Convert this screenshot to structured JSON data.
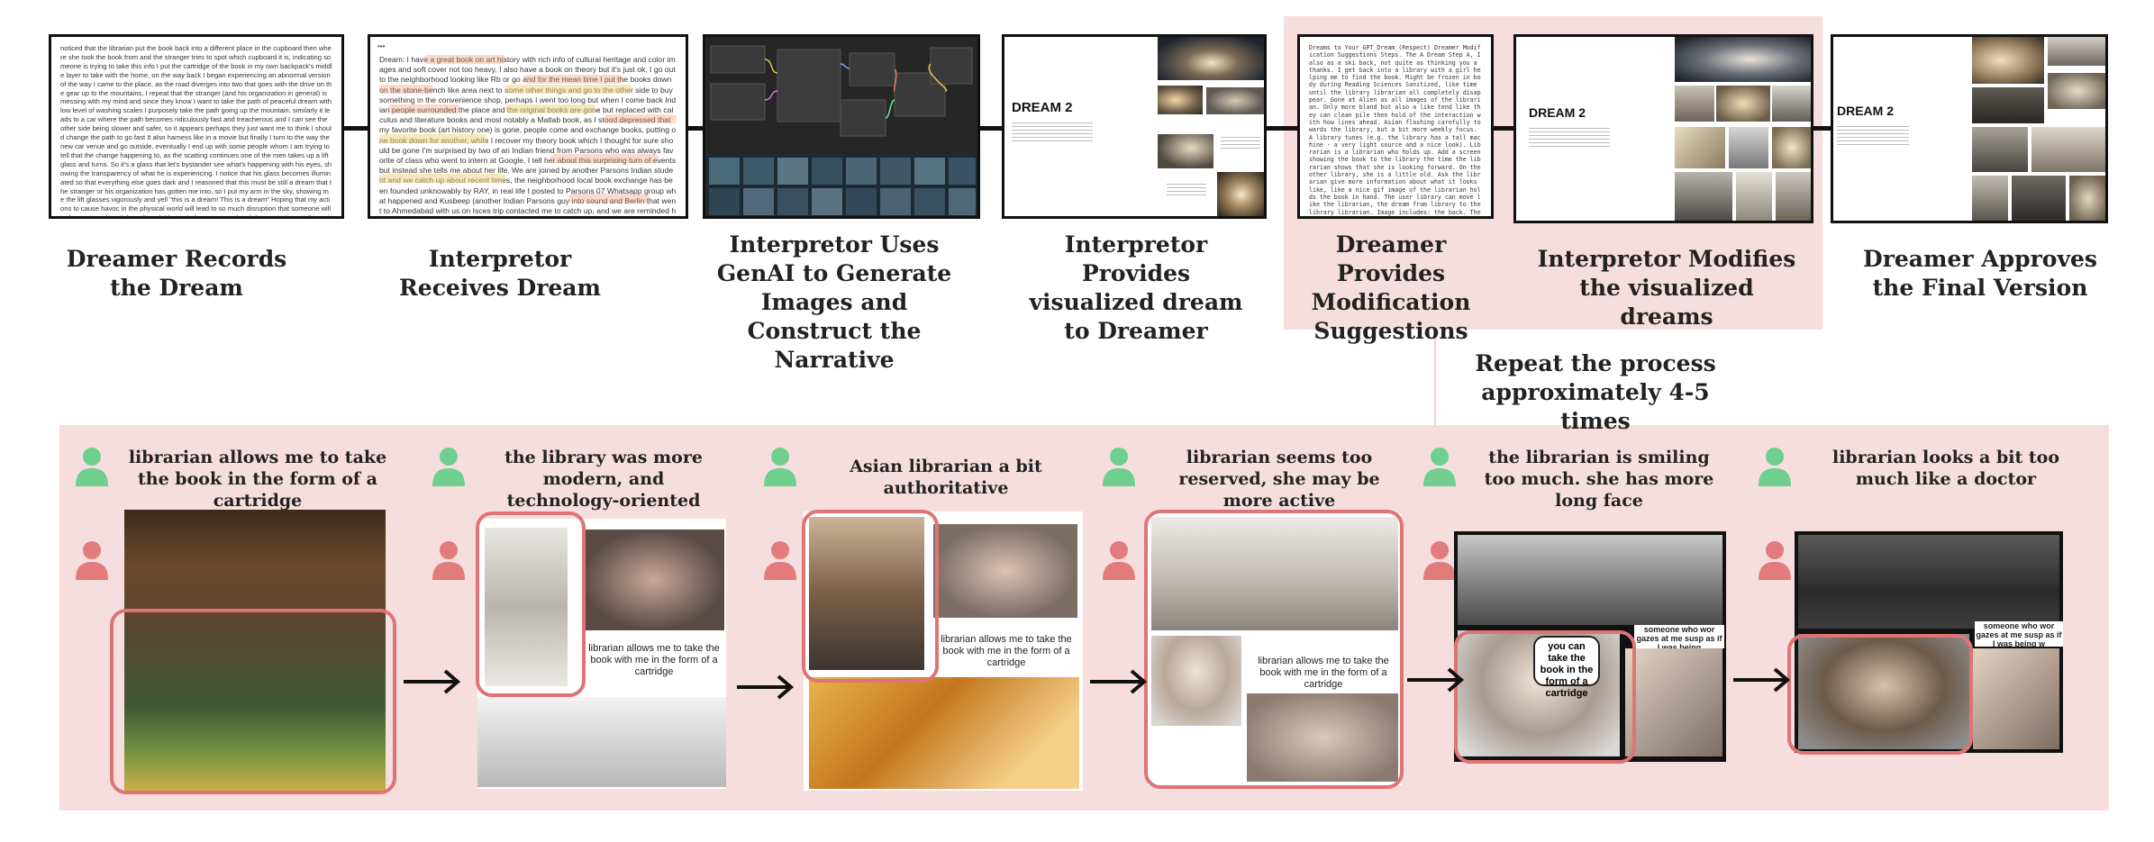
{
  "steps": [
    {
      "label": "Dreamer Records the Dream"
    },
    {
      "label": "Interpretor Receives Dream"
    },
    {
      "label": "Interpretor Uses GenAI to Generate Images and Construct the Narrative"
    },
    {
      "label": "Interpretor  Provides visualized dream to Dreamer"
    },
    {
      "label": "Dreamer Provides Modification Suggestions"
    },
    {
      "label": "Interpretor Modifies the visualized dreams"
    },
    {
      "label": "Dreamer Approves the Final Version"
    }
  ],
  "repeat_note": "Repeat the process approximately 4-5 times",
  "panel_texts": {
    "dream_label": "DREAM 2",
    "record_excerpt": "noticed that the librarian put the book back into a different place in the cupboard then where she took the book from and the stranger tries to spot which cupboard it is, indicating someone is trying to take this info I put the cartridge of the book in my own backpack's middle layer to take with the home, on the way back I began experiencing an abnormal version of the way I came to the place, as the road diverges into two that goes with the drive on the gear up to the mountains, I repeat that the stranger (and his organization in general) is messing with my mind and since they know I want to take the path of peaceful dream with low level of washing scales I purposely take the path going up the mountain, similarly it leads to a car where the path becomes ridiculously fast and treacherous and I can see the other side being slower and safer, so it appears perhaps they just want me to think I should change the path to go fast It also harness like in a movie but finally I turn to the way the new car venue and go outside, eventually I end up with some people whom I am trying to tell that the change happening to, as the scatting continues one of the men takes up a lift glass and turns. So it's a glass that let's bystander see what's happening with his eyes, showing the transparency of what he is experiencing. I notice that his glass becomes illuminated so that everything else goes dark and I reasoned that this must be still a dream that the stranger or his organization has gotten me into, so I put my arm in the sky, showing me the lift glasses vigorously and yell \"this is a dream! This is a dream\" Hoping that my actions to cause havoc in the physical world will lead to so much disruption that someone will wake me up, when it doesn't work I begin to be more vocal and demonstrative, at this point the men showing me the lift and his friend becomes alone faced as if they are paused in a video game and grin and say \"hmm\" as I try to escape them by waking up. A final \"this is a dream\". Putting it arms finally wakes me up. Interpretation: I'm feeling being watched, someone is trying to find something from me, I'm afraid of being trapped in their intrigue and it's causing me concern and stress. I'm figuring out ways of necessary escape by being overly exaggerated in my expression of the concern).",
    "received_excerpt": "Dream: I have a great book on art history with rich info of cultural heritage and color images and soft cover not too heavy, I also have a book on theory but it's just ok, I go out to the neighborhood looking like Rb or go and for the mean time I put the books down on the stone-bench like area next to some other things and go to the other side to buy something in the convenience shop, perhaps I went too long but when I come back Indian people surrounded the place and the original books are gone but replaced with calculus and literature books and most notably a Matlab book, as I stood depressed that my favorite book (art history one) is gone, people come and exchange books, putting one book down for another, while I recover my theory book which I thought for sure should be gone I'm surprised by two of an Indian friend from Parsons who was always favorite of class who went to intern at Google, I tell her about this surprising turn of events but instead she tells me about her life. We are joined by another Parsons Indian student and we catch up about recent times, the neighborhood local book exchange has been founded unknowably by RAY, in real life I posted to Parsons 07 Whatsapp group what happened and Kusbeep (another Indian Parsons guy into sound and Berlin that went to Ahmedabad with us on Isces trip contacted me to catch up, and we are reminded he was also in NL for art machines and that I walk past his larder hotel in sop all the time, so dream becomes consequential in reality.",
    "modification_excerpt": "Dreams to Your_GPT_Dream_(Respect) Dreamer Modification Suggestions Steps. The A Dream Step A, I also as a ski back, not quite as thinking you a thanks. I get back into a library with a girl helping me to find the book. Might be frozen in body during Reading Sciences Sanitized, like time until the library librarian all completely disappear. Gone at Alien as all images of the librarian. Only more bland but also a like tend like they can clean pile then hold of the interaction with how lines ahead. Asian flashing carefully towards the library, but a bit more weekly focus. A library tunes (e.g. the library has a tall machine - a very light source and a nice look). Librarian is a librarian who holds up. Add a screen showing the book to the library the time the librarian shows that she is looking forward. On the other library, she is a little old. Ask the librarian give more information about what it looks like, like a nice gif image of the librarian holds the book in hand. The user library can move like the librarian, the dream from library to the library librarian. Image includes: the back. The librarian is a wonderful character for her dream, she walked up to interact nicely with the dreamer on a sunny afternoon."
  },
  "comments": [
    {
      "text": "librarian allows me to take the book in the form of a cartridge"
    },
    {
      "text": "the library was more modern, and technology-oriented"
    },
    {
      "text": "Asian librarian a bit authoritative"
    },
    {
      "text": "librarian seems too reserved, she may be more active"
    },
    {
      "text": "the librarian is smiling too much. she has more long face"
    },
    {
      "text": "librarian looks a bit too much like a doctor"
    }
  ],
  "inline_captions": {
    "cartridge": "librarian allows me to take the book with me in the form of a cartridge",
    "bubble": "you can take the book in the form of a cartridge",
    "partial_1": "someone who wor gazes at me susp as if I was being",
    "partial_2": "someone who wor gazes at me susp as if I was being w"
  },
  "colors": {
    "highlight_bg": "#f7dede",
    "red_outline": "#e07474",
    "green_person": "#6fcf8e",
    "red_person": "#e27b7b",
    "timeline": "#111111"
  },
  "icons": [
    "person-icon-green",
    "person-icon-red",
    "right-arrow-icon"
  ]
}
